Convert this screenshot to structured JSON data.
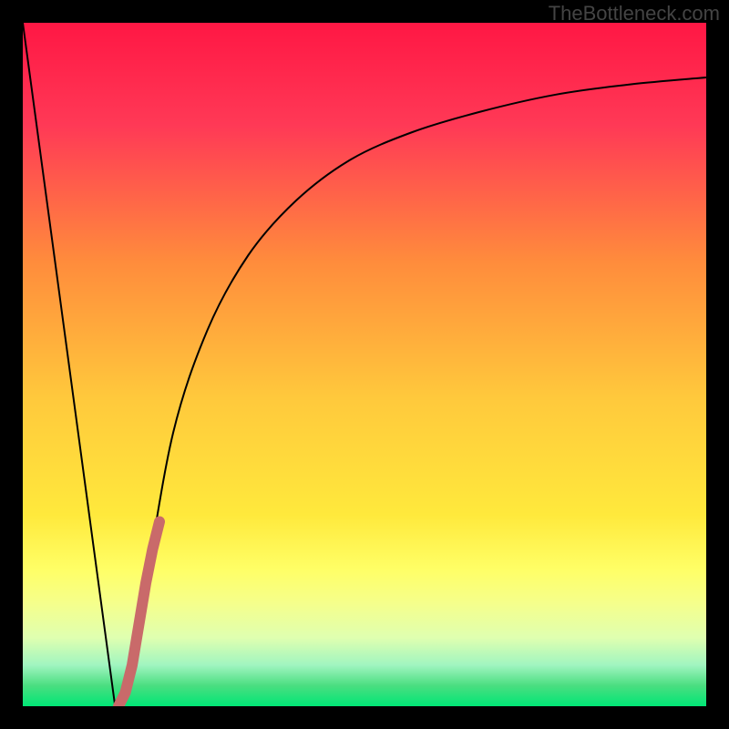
{
  "watermark": "TheBottleneck.com",
  "chart_data": {
    "type": "line",
    "title": "",
    "xlabel": "",
    "ylabel": "",
    "xlim": [
      0,
      100
    ],
    "ylim": [
      0,
      100
    ],
    "background_gradient": {
      "type": "vertical",
      "stops": [
        {
          "pos": 0,
          "color": "#FF1744"
        },
        {
          "pos": 15,
          "color": "#FF3956"
        },
        {
          "pos": 35,
          "color": "#FF8C3C"
        },
        {
          "pos": 55,
          "color": "#FFC93C"
        },
        {
          "pos": 72,
          "color": "#FFE93C"
        },
        {
          "pos": 80,
          "color": "#FFFF66"
        },
        {
          "pos": 85,
          "color": "#F5FF8C"
        },
        {
          "pos": 90,
          "color": "#DFFFB0"
        },
        {
          "pos": 94,
          "color": "#A0F5C0"
        },
        {
          "pos": 97,
          "color": "#4ADE80"
        },
        {
          "pos": 100,
          "color": "#00E676"
        }
      ]
    },
    "series": [
      {
        "name": "main-curve",
        "color": "#000000",
        "width": 2,
        "x": [
          0,
          13.5,
          15,
          18,
          22,
          27,
          33,
          40,
          48,
          57,
          67,
          78,
          89,
          100
        ],
        "y": [
          100,
          0,
          2,
          18,
          40,
          55,
          66,
          74,
          80,
          84,
          87,
          89.5,
          91,
          92
        ]
      },
      {
        "name": "highlight-segment",
        "color": "#C96A6A",
        "width": 12,
        "x": [
          14,
          15,
          16,
          17,
          18,
          19,
          20
        ],
        "y": [
          0,
          2,
          6,
          12,
          18,
          23,
          27
        ]
      }
    ]
  }
}
